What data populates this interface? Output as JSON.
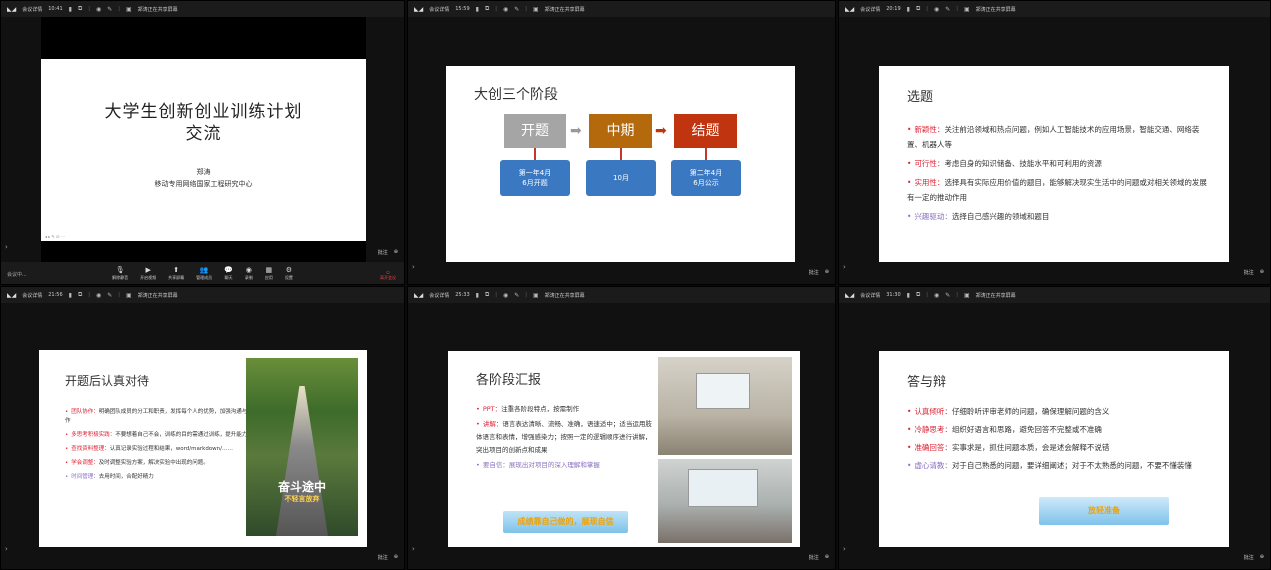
{
  "topbars": [
    {
      "app": "会议详情",
      "time": "10:41",
      "share": "郑涛正在共享屏幕"
    },
    {
      "app": "会议详情",
      "time": "15:59",
      "share": "郑涛正在共享屏幕"
    },
    {
      "app": "会议详情",
      "time": "20:19",
      "share": "郑涛正在共享屏幕"
    },
    {
      "app": "会议详情",
      "time": "21:56",
      "share": "郑涛正在共享屏幕"
    },
    {
      "app": "会议详情",
      "time": "25:33",
      "share": "郑涛正在共享屏幕"
    },
    {
      "app": "会议详情",
      "time": "31:30",
      "share": "郑涛正在共享屏幕"
    }
  ],
  "toolbar": {
    "items": [
      "解除静音",
      "开启视频",
      "共享屏幕",
      "管理成员",
      "聊天",
      "录制",
      "应用",
      "设置"
    ],
    "leave": "离开会议",
    "status": "会议中..."
  },
  "annotate_label": "批注",
  "slide0": {
    "title_line1": "大学生创新创业训练计划",
    "title_line2": "交流",
    "name": "郑涛",
    "org": "移动专用网络国家工程研究中心"
  },
  "slide1": {
    "heading": "大创三个阶段",
    "stages": [
      "开题",
      "中期",
      "结题"
    ],
    "dates": [
      {
        "line1": "第一年4月",
        "line2": "6月开题"
      },
      {
        "line1": "10月",
        "line2": ""
      },
      {
        "line1": "第二年4月",
        "line2": "6月公示"
      }
    ]
  },
  "slide2": {
    "heading": "选题",
    "items": [
      {
        "key": "新颖性：",
        "text": "关注前沿领域和热点问题，例如人工智能技术的应用场景，智能交通、网络装置、机器人等"
      },
      {
        "key": "可行性：",
        "text": "考虑自身的知识储备、技能水平和可利用的资源"
      },
      {
        "key": "实用性：",
        "text": "选择具有实际应用价值的题目，能够解决现实生活中的问题或对相关领域的发展有一定的推动作用"
      },
      {
        "key": "兴趣驱动：",
        "text": "选择自己感兴趣的领域和题目"
      }
    ]
  },
  "slide3": {
    "heading": "开题后认真对待",
    "items": [
      {
        "key": "团队协作：",
        "text": "明确团队成员的分工和职责，发挥每个人的优势，加强沟通与协作"
      },
      {
        "key": "多思考积极实践：",
        "text": "不要想着自己不会，训练的目的需通过训练，提升能力"
      },
      {
        "key": "查找资料整理：",
        "text": "认真记录实验过程和结果，word/markdown/……"
      },
      {
        "key": "学会调整：",
        "text": "及时调整实验方案，解决实验中出现的问题。"
      },
      {
        "key": "时间管理：",
        "text": "去用时间，合配好精力"
      }
    ],
    "book_title": "奋斗途中",
    "book_subtitle": "不轻言放弃"
  },
  "slide4": {
    "heading": "各阶段汇报",
    "items": [
      {
        "key": "PPT：",
        "text": "注重各阶段特点，按需制作"
      },
      {
        "key": "讲解：",
        "text": "语言表达清晰、流畅、准确，语速适中；适当运用肢体语言和表情，增强感染力；按照一定的逻辑顺序进行讲解，突出项目的创新点和成果"
      },
      {
        "key": "要自信：",
        "text": "展现出对项目的深入理解和掌握"
      }
    ],
    "banner": "成绩靠自己做的，展现自信"
  },
  "slide5": {
    "heading": "答与辩",
    "items": [
      {
        "key": "认真倾听：",
        "text": "仔细聆听评审老师的问题，确保理解问题的含义"
      },
      {
        "key": "冷静思考：",
        "text": "组织好语言和思路，避免回答不完整或不准确"
      },
      {
        "key": "准确回答：",
        "text": "实事求是，抓住问题本质，会是述会解释不说错"
      },
      {
        "key": "虚心请教：",
        "text": "对于自己熟悉的问题，要详细阐述；对于不太熟悉的问题，不要不懂装懂"
      }
    ],
    "banner": "放轻准备"
  }
}
